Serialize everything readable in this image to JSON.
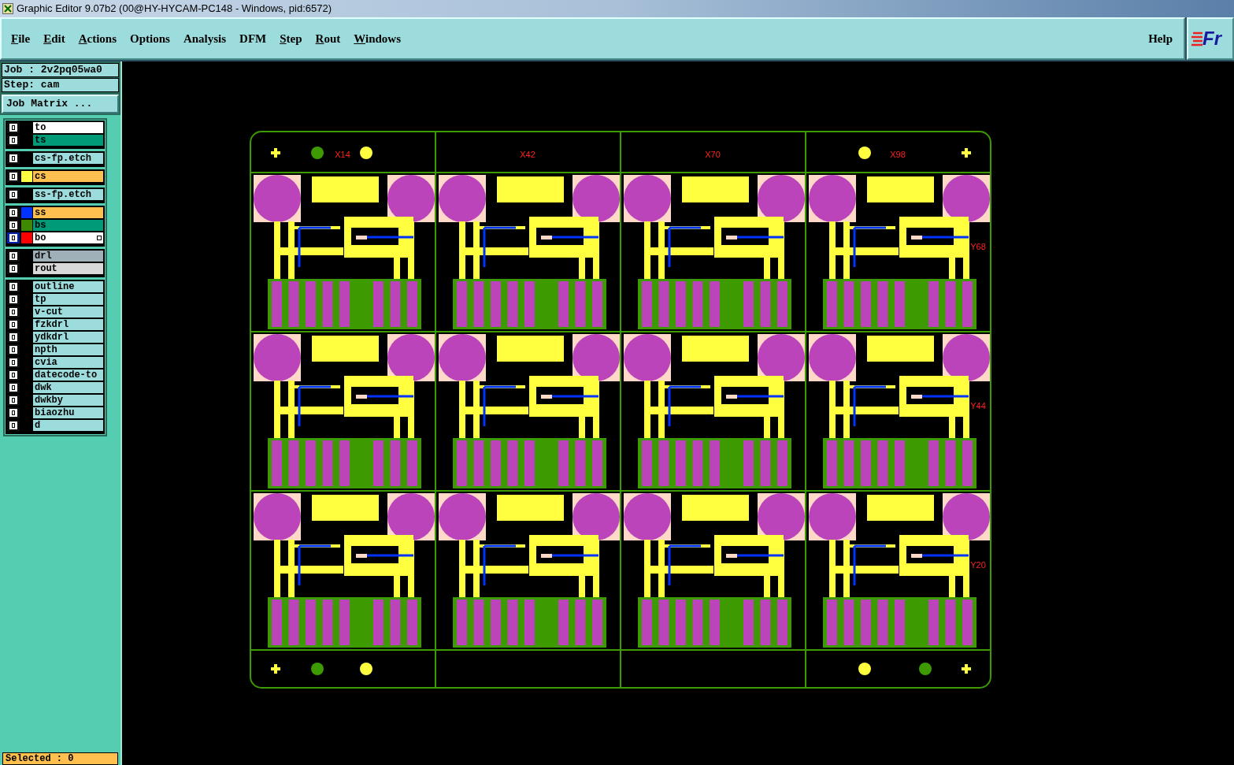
{
  "window": {
    "title": "Graphic Editor 9.07b2 (00@HY-HYCAM-PC148 - Windows, pid:6572)"
  },
  "menu": [
    {
      "label": "File",
      "mnemonic": true
    },
    {
      "label": "Edit",
      "mnemonic": true
    },
    {
      "label": "Actions",
      "mnemonic": true
    },
    {
      "label": "Options",
      "mnemonic": false
    },
    {
      "label": "Analysis",
      "mnemonic": false
    },
    {
      "label": "DFM",
      "mnemonic": false
    },
    {
      "label": "Step",
      "mnemonic": true
    },
    {
      "label": "Rout",
      "mnemonic": true
    },
    {
      "label": "Windows",
      "mnemonic": true
    }
  ],
  "help": "Help",
  "logo_text": "Fr",
  "job": "Job : 2v2pq05wa0",
  "step": "Step: cam",
  "job_matrix_button": "Job Matrix ...",
  "layer_groups": [
    [
      {
        "name": "to",
        "kind": "silk-screen",
        "selected": false
      },
      {
        "name": "ts",
        "kind": "solder-mask",
        "selected": false
      }
    ],
    [
      {
        "name": "cs-fp.etch",
        "kind": "document",
        "selected": false
      }
    ],
    [
      {
        "name": "cs",
        "color": "#ffff40",
        "kind": "signal",
        "selected": false
      }
    ],
    [
      {
        "name": "ss-fp.etch",
        "kind": "document",
        "selected": false
      }
    ],
    [
      {
        "name": "ss",
        "color": "#0033ff",
        "kind": "signal",
        "selected": false
      },
      {
        "name": "bs",
        "color": "#3d8a00",
        "kind": "solder-mask",
        "selected": false
      },
      {
        "name": "bo",
        "color": "#ff0000",
        "kind": "silk-screen",
        "selected": true
      }
    ],
    [
      {
        "name": "drl",
        "kind": "drill",
        "selected": false
      },
      {
        "name": "rout",
        "kind": "rout",
        "selected": false
      }
    ],
    [
      {
        "name": "outline",
        "kind": "document",
        "selected": false
      },
      {
        "name": "tp",
        "kind": "document",
        "selected": false
      },
      {
        "name": "v-cut",
        "kind": "document",
        "selected": false
      },
      {
        "name": "fzkdrl",
        "kind": "document",
        "selected": false
      },
      {
        "name": "ydkdrl",
        "kind": "document",
        "selected": false
      },
      {
        "name": "npth",
        "kind": "document",
        "selected": false
      },
      {
        "name": "cvia",
        "kind": "document",
        "selected": false
      },
      {
        "name": "datecode-to",
        "kind": "document",
        "selected": false
      },
      {
        "name": "dwk",
        "kind": "document",
        "selected": false
      },
      {
        "name": "dwkby",
        "kind": "document",
        "selected": false
      },
      {
        "name": "biaozhu",
        "kind": "document",
        "selected": false
      },
      {
        "name": "d",
        "kind": "document",
        "selected": false
      }
    ]
  ],
  "board_labels_top": [
    "X14",
    "X42",
    "X70",
    "X98"
  ],
  "board_labels_right": [
    "Y68",
    "Y44",
    "Y20"
  ],
  "status": "Selected : 0"
}
